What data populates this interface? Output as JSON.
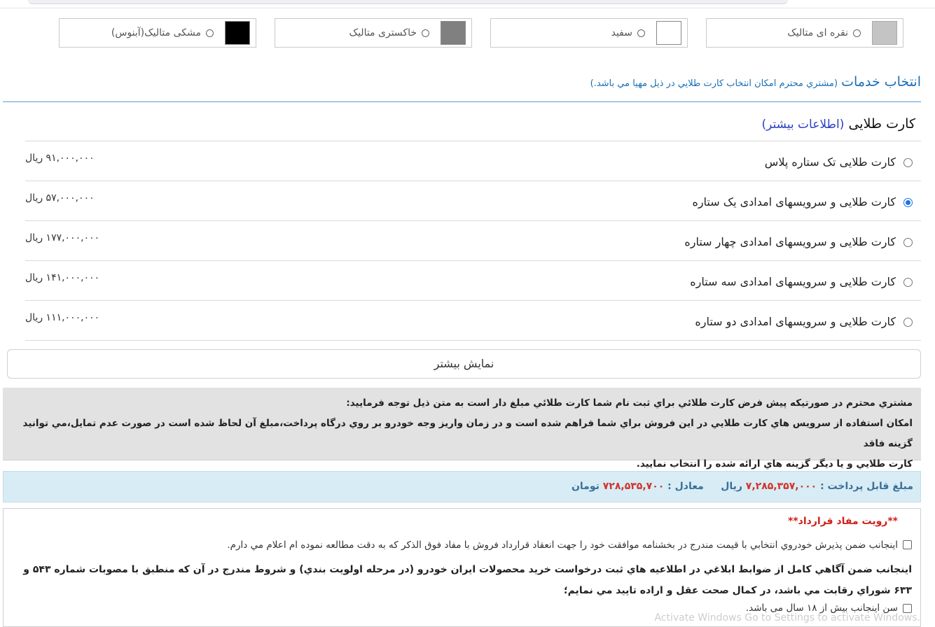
{
  "colors": [
    {
      "label": "نقره ای متالیک",
      "swatch": "#c4c4c4"
    },
    {
      "label": "سفید",
      "swatch": "#ffffff"
    },
    {
      "label": "خاکستری متالیک",
      "swatch": "#808080"
    },
    {
      "label": "مشکی متالیک(آبنوس)",
      "swatch": "#000000"
    }
  ],
  "services": {
    "title": "انتخاب خدمات",
    "subtitle": "(مشتري محترم امكان انتخاب كارت طلايي در ذيل مهيا مي باشد.)"
  },
  "gold_card": {
    "title": "کارت طلایی",
    "more_info": "(اطلاعات بیشتر)",
    "options": [
      {
        "label": "کارت طلایی تک ستاره پلاس",
        "price": "۹۱,۰۰۰,۰۰۰ ریال",
        "selected": false
      },
      {
        "label": "کارت طلایی و سرویسهای امدادی یک ستاره",
        "price": "۵۷,۰۰۰,۰۰۰ ریال",
        "selected": true
      },
      {
        "label": "کارت طلایی و سرویسهای امدادی چهار ستاره",
        "price": "۱۷۷,۰۰۰,۰۰۰ ریال",
        "selected": false
      },
      {
        "label": "کارت طلایی و سرویسهای امدادی سه ستاره",
        "price": "۱۴۱,۰۰۰,۰۰۰ ریال",
        "selected": false
      },
      {
        "label": "کارت طلایی و سرویسهای امدادی دو ستاره",
        "price": "۱۱۱,۰۰۰,۰۰۰ ریال",
        "selected": false
      }
    ],
    "show_more": "نمایش بیشتر"
  },
  "notice": {
    "line1": "مشتري محترم در صورتيكه پيش فرض كارت طلائي براي ثبت نام شما كارت طلائي مبلغ دار است به متن ذيل توجه فرماييد:",
    "line2": "امكان استفاده از سرويس هاي كارت طلايي در اين فروش براي شما فراهم شده است و در زمان واريز وجه خودرو بر روي درگاه پرداخت،مبلغ آن لحاظ شده است در صورت عدم تمايل،مي توانيد گزينه فاقد",
    "line3": "كارت طلايي و يا ديگر گزينه هاي ارائه شده را انتخاب نماييد."
  },
  "payable": {
    "label": "مبلغ قابل پرداخت :",
    "amount": "۷,۲۸۵,۳۵۷,۰۰۰",
    "currency": "ریال",
    "equiv_label": "معادل :",
    "equiv_amount": "۷۲۸,۵۳۵,۷۰۰",
    "equiv_currency": "تومان"
  },
  "contract": {
    "title": "**رویت مفاد قرارداد**",
    "agree1": "اينجانب ضمن پذيرش خودروي انتخابي با قيمت مندرج در بخشنامه موافقت خود را جهت انعقاد قرارداد فروش با مفاد فوق الذكر كه به دقت مطالعه نموده ام اعلام مي دارم.",
    "rules": "اينجانب ضمن آگاهي كامل از ضوابط ابلاغي در اطلاعيه هاي ثبت درخواست خريد محصولات ايران خودرو (در مرحله اولويت بندي) و شروط مندرج در آن كه منطبق با مصوبات شماره ۵۴۳ و ۶۳۳ شوراي رقابت مي باشد، در كمال صحت عقل و اراده تاييد مي نمايم؛",
    "age": "سن اینجانب بیش از ۱۸ سال می باشد."
  },
  "watermark": "Activate Windows\nGo to Settings to activate Windows."
}
